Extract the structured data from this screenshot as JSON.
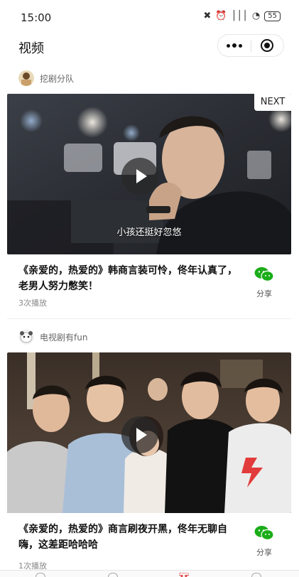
{
  "status_bar": {
    "time": "15:00",
    "battery": "55",
    "signal": "│││",
    "wifi": "◔",
    "alarm": "⏰",
    "mute": "✖"
  },
  "nav": {
    "title": "视频",
    "more_icon": "more-dots-icon",
    "close_icon": "target-close-icon"
  },
  "feed": [
    {
      "author": "挖剧分队",
      "subtitle": "小孩还挺好忽悠",
      "next_label": "NEXT",
      "title": "《亲爱的，热爱的》韩商言装可怜，佟年认真了，老男人努力憋笑！",
      "play_count": "3次播放",
      "share_label": "分享"
    },
    {
      "author": "电视剧有fun",
      "title": "《亲爱的，热爱的》商言刷夜开黑，佟年无聊自嗨，这差距哈哈哈",
      "play_count": "1次播放",
      "share_label": "分享"
    }
  ],
  "colors": {
    "accent": "#e24b4b",
    "wechat_green": "#1aad19"
  }
}
